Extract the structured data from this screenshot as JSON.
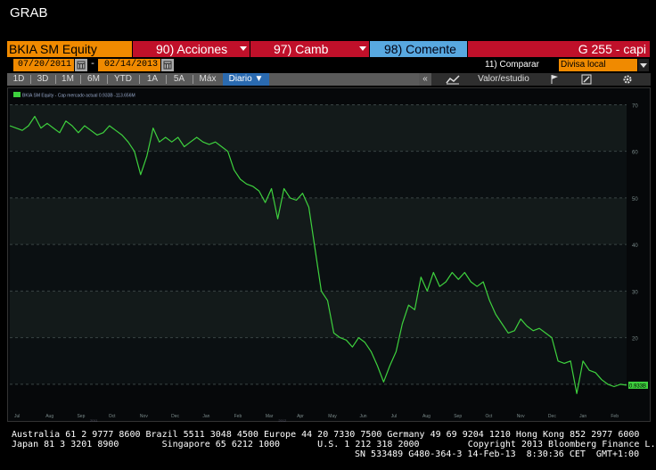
{
  "window": {
    "title": "GRAB"
  },
  "header": {
    "ticker": "BKIA SM Equity",
    "actions_label": "90) Acciones",
    "changes_label": "97) Camb",
    "comment_label": "98) Comente",
    "chart_code": "G 255 - capi"
  },
  "dates": {
    "start": "07/20/2011",
    "end": "02/14/2013",
    "compare_label": "11) Comparar",
    "currency_label": "Divisa local"
  },
  "toolbar": {
    "ranges": [
      "1D",
      "3D",
      "1M",
      "6M",
      "YTD",
      "1A",
      "5A",
      "Máx"
    ],
    "period_label": "Diario ▼",
    "study_label": "Valor/estudio",
    "collapse_label": "«"
  },
  "footer": {
    "line1": "Australia 61 2 9777 8600 Brazil 5511 3048 4500 Europe 44 20 7330 7500 Germany 49 69 9204 1210 Hong Kong 852 2977 6000",
    "line2": "Japan 81 3 3201 8900        Singapore 65 6212 1000       U.S. 1 212 318 2000         Copyright 2013 Bloomberg Finance L.P.",
    "line3": "SN 533489 G480-364-3 14-Feb-13  8:30:36 CET  GMT+1:00"
  },
  "colors": {
    "line": "#3ed13e",
    "accent_orange": "#f08a00",
    "accent_red": "#c0102a",
    "accent_blue": "#58a8e0"
  },
  "chart_data": {
    "type": "line",
    "legend": "BKIA SM Equity - Cap mercado actual  0.933B  -113.656M",
    "last_value_label": "0.933B",
    "y_ticks": [
      "70",
      "60",
      "50",
      "40",
      "30",
      "20",
      "10"
    ],
    "ylim": [
      5,
      72
    ],
    "x_month_labels": [
      "Jul",
      "Aug",
      "Sep",
      "Oct",
      "Nov",
      "Dec",
      "Jan",
      "Feb",
      "Mar",
      "Apr",
      "May",
      "Jun",
      "Jul",
      "Aug",
      "Sep",
      "Oct",
      "Nov",
      "Dec",
      "Jan",
      "Feb"
    ],
    "x_year_labels": [
      "2011",
      "2012",
      "2013"
    ],
    "grid": true,
    "series": [
      {
        "values": [
          65.5,
          65.0,
          64.5,
          65.5,
          67.5,
          65.0,
          66.0,
          65.0,
          64.0,
          66.5,
          65.5,
          64.0,
          65.5,
          64.5,
          63.5,
          64.0,
          65.5,
          64.5,
          63.5,
          62.0,
          60.0,
          55.0,
          59.0,
          65.0,
          62.0,
          63.0,
          62.0,
          63.0,
          61.0,
          62.0,
          63.0,
          62.0,
          61.5,
          62.0,
          61.0,
          60.0,
          56.0,
          54.0,
          53.0,
          52.5,
          51.5,
          49.0,
          52.0,
          45.5,
          52.0,
          50.0,
          49.5,
          51.0,
          48.0,
          39.0,
          30.0,
          28.0,
          21.0,
          20.0,
          19.5,
          18.0,
          20.0,
          19.0,
          17.0,
          14.0,
          10.5,
          14.0,
          17.0,
          23.0,
          27.0,
          26.0,
          33.0,
          30.0,
          34.0,
          31.0,
          32.0,
          34.0,
          32.5,
          34.0,
          32.0,
          31.0,
          32.0,
          28.0,
          25.0,
          23.0,
          21.0,
          21.5,
          24.0,
          22.5,
          21.5,
          22.0,
          21.0,
          20.0,
          15.0,
          14.5,
          15.0,
          8.0,
          15.0,
          13.0,
          12.5,
          11.0,
          10.0,
          9.5,
          10.0,
          9.8
        ]
      }
    ]
  }
}
